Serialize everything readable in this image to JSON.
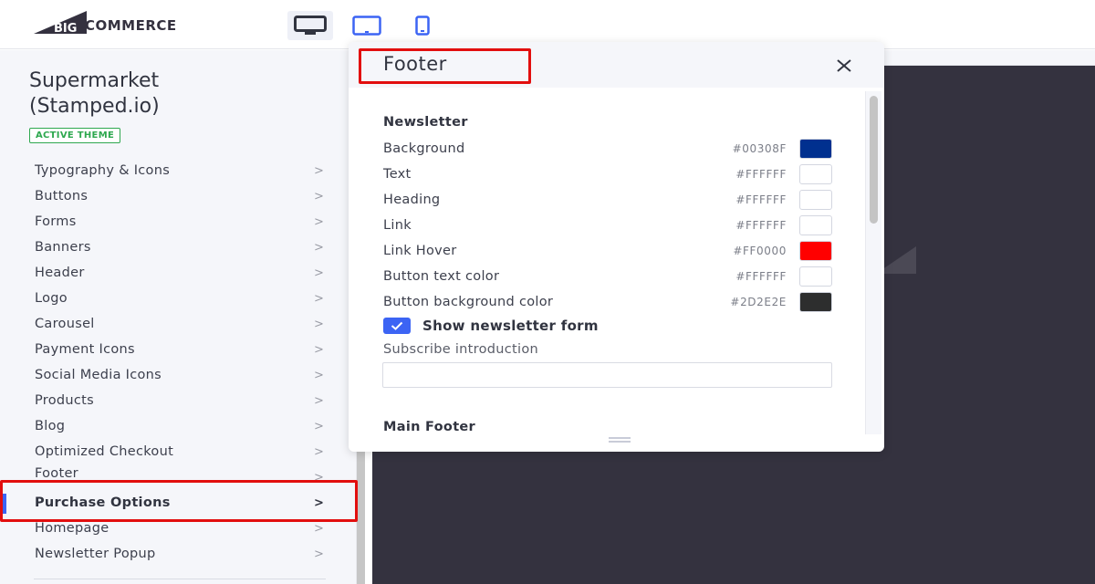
{
  "topbar": {
    "logo_text": "COMMERCE",
    "logo_prefix": "BIG",
    "devices": [
      {
        "name": "desktop",
        "icon": "desktop-icon",
        "active": true
      },
      {
        "name": "tablet",
        "icon": "tablet-icon",
        "active": false
      },
      {
        "name": "mobile",
        "icon": "mobile-icon",
        "active": false
      }
    ]
  },
  "sidebar": {
    "theme_name_line1": "Supermarket",
    "theme_name_line2": "(Stamped.io)",
    "badge": "ACTIVE THEME",
    "chevron": ">",
    "items": [
      {
        "label": "Typography & Icons"
      },
      {
        "label": "Buttons"
      },
      {
        "label": "Forms"
      },
      {
        "label": "Banners"
      },
      {
        "label": "Header"
      },
      {
        "label": "Logo"
      },
      {
        "label": "Carousel"
      },
      {
        "label": "Payment Icons"
      },
      {
        "label": "Social Media Icons"
      },
      {
        "label": "Products"
      },
      {
        "label": "Blog"
      },
      {
        "label": "Optimized Checkout"
      },
      {
        "label": "Footer"
      },
      {
        "label": "Purchase Options",
        "selected": true
      },
      {
        "label": "Homepage"
      },
      {
        "label": "Newsletter Popup"
      }
    ]
  },
  "panel": {
    "title": "Footer",
    "close_icon": "×",
    "newsletter_heading": "Newsletter",
    "colors": [
      {
        "label": "Background",
        "hex": "#00308F",
        "swatch": "#00308F"
      },
      {
        "label": "Text",
        "hex": "#FFFFFF",
        "swatch": "#FFFFFF"
      },
      {
        "label": "Heading",
        "hex": "#FFFFFF",
        "swatch": "#FFFFFF"
      },
      {
        "label": "Link",
        "hex": "#FFFFFF",
        "swatch": "#FFFFFF"
      },
      {
        "label": "Link Hover",
        "hex": "#FF0000",
        "swatch": "#FF0000"
      },
      {
        "label": "Button text color",
        "hex": "#FFFFFF",
        "swatch": "#FFFFFF"
      },
      {
        "label": "Button background color",
        "hex": "#2D2E2E",
        "swatch": "#2D2E2E"
      }
    ],
    "show_newsletter": {
      "label": "Show newsletter form",
      "checked": true
    },
    "subscribe_intro": {
      "label": "Subscribe introduction",
      "value": "",
      "placeholder": ""
    },
    "main_footer_heading": "Main Footer"
  },
  "colors": {
    "accent": "#3C64F4",
    "badge_green": "#2EA84F",
    "annotation_red": "#E20E0E",
    "preview_bg": "#34323F"
  }
}
